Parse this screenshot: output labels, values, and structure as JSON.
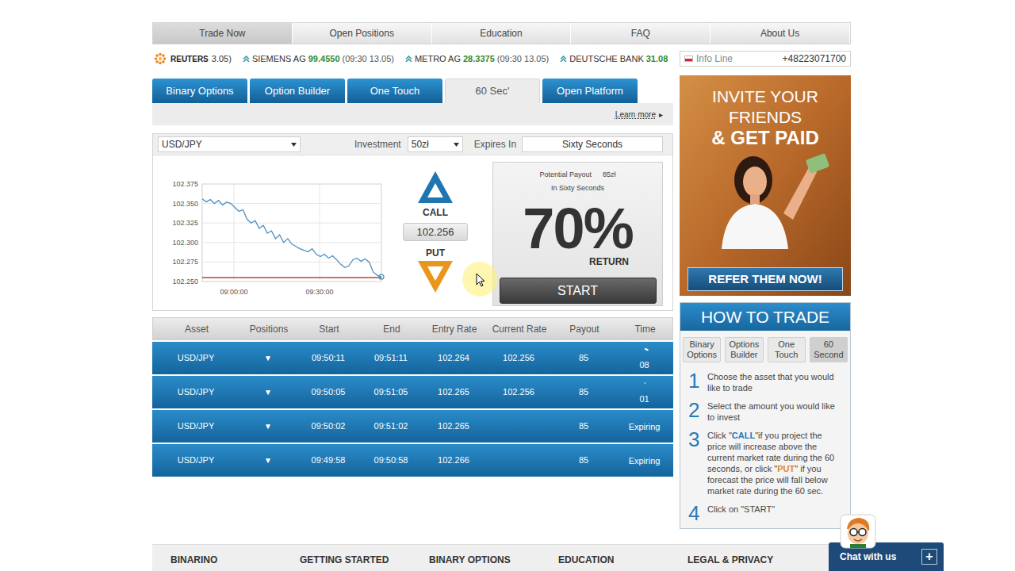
{
  "nav": [
    {
      "label": "Trade Now",
      "selected": true
    },
    {
      "label": "Open Positions",
      "selected": false
    },
    {
      "label": "Education",
      "selected": false
    },
    {
      "label": "FAQ",
      "selected": false
    },
    {
      "label": "About Us",
      "selected": false
    }
  ],
  "ticker": {
    "source": "REUTERS",
    "fragment": "3.05)",
    "items": [
      {
        "name": "SIEMENS AG",
        "value": "99.4550",
        "time": "(09:30 13.05)"
      },
      {
        "name": "METRO AG",
        "value": "28.3375",
        "time": "(09:30 13.05)"
      },
      {
        "name": "DEUTSCHE BANK",
        "value": "31.08"
      }
    ]
  },
  "info_line": {
    "label": "Info Line",
    "phone": "+48223071700"
  },
  "product_tabs": [
    {
      "label": "Binary Options",
      "selected": false
    },
    {
      "label": "Option Builder",
      "selected": false
    },
    {
      "label": "One Touch",
      "selected": false
    },
    {
      "label": "60 Sec'",
      "selected": true
    },
    {
      "label": "Open Platform",
      "selected": false
    }
  ],
  "learn_more": {
    "label": "Learn more",
    "arrow": "▸"
  },
  "trade": {
    "asset": "USD/JPY",
    "investment_label": "Investment",
    "investment": "50zł",
    "expires_label": "Expires In",
    "expires": "Sixty Seconds",
    "call_label": "CALL",
    "put_label": "PUT",
    "price": "102.256",
    "payout_label": "Potential Payout",
    "payout": "85zł",
    "payout_period": "In Sixty Seconds",
    "return_percent": "70%",
    "return_label": "RETURN",
    "start": "START"
  },
  "chart": {
    "y_ticks": [
      "102.375",
      "102.350",
      "102.325",
      "102.300",
      "102.275",
      "102.250"
    ],
    "x_ticks": [
      "09:00:00",
      "09:30:00"
    ],
    "series": [
      {
        "values": [
          102.356,
          102.352,
          102.355,
          102.35,
          102.354,
          102.348,
          102.352,
          102.35,
          102.345,
          102.34,
          102.342,
          102.33,
          102.325,
          102.328,
          102.318,
          102.322,
          102.312,
          102.315,
          102.305,
          102.31,
          102.3,
          102.305,
          102.298,
          102.295,
          102.292,
          102.29,
          102.288,
          102.292,
          102.285,
          102.282,
          102.285,
          102.28,
          102.283,
          102.278,
          102.272,
          102.268,
          102.27,
          102.278,
          102.28,
          102.276,
          102.279,
          102.275,
          102.262,
          102.258,
          102.256
        ]
      }
    ],
    "current_line": 102.255
  },
  "positions": {
    "columns": [
      "Asset",
      "Positions",
      "Start",
      "End",
      "Entry Rate",
      "Current Rate",
      "Payout",
      "Time"
    ],
    "rows": [
      {
        "asset": "USD/JPY",
        "position": "▼",
        "start": "09:50:11",
        "end": "09:51:11",
        "entry_rate": "102.264",
        "current_rate": "102.256",
        "payout": "85",
        "time": "08",
        "countdown_level": 0.13
      },
      {
        "asset": "USD/JPY",
        "position": "▼",
        "start": "09:50:05",
        "end": "09:51:05",
        "entry_rate": "102.265",
        "current_rate": "102.256",
        "payout": "85",
        "time": "01",
        "countdown_level": 0.02
      },
      {
        "asset": "USD/JPY",
        "position": "▼",
        "start": "09:50:02",
        "end": "09:51:02",
        "entry_rate": "102.265",
        "payout": "85",
        "time": "Expiring"
      },
      {
        "asset": "USD/JPY",
        "position": "▼",
        "start": "09:49:58",
        "end": "09:50:58",
        "entry_rate": "102.266",
        "payout": "85",
        "time": "Expiring"
      }
    ]
  },
  "banner": {
    "lines": [
      "INVITE YOUR",
      "FRIENDS",
      "& GET PAID"
    ],
    "button": "REFER THEM NOW!"
  },
  "how_to_trade": {
    "title": "HOW TO TRADE",
    "tabs": [
      {
        "label": "Binary Options",
        "selected": false
      },
      {
        "label": "Options Builder",
        "selected": false
      },
      {
        "label": "One Touch",
        "selected": false
      },
      {
        "label": "60 Second",
        "selected": true
      }
    ],
    "steps": [
      {
        "number": "1",
        "segments": [
          {
            "text": "Choose the asset that you would like to trade",
            "kind": "plain"
          }
        ]
      },
      {
        "number": "2",
        "segments": [
          {
            "text": "Select the amount you would like to invest",
            "kind": "plain"
          }
        ]
      },
      {
        "number": "3",
        "segments": [
          {
            "text": "Click \"",
            "kind": "plain"
          },
          {
            "text": "CALL",
            "kind": "call"
          },
          {
            "text": "\"if you project the price will increase above the current market rate during the 60 seconds, or click \"",
            "kind": "plain"
          },
          {
            "text": "PUT",
            "kind": "put"
          },
          {
            "text": "\" if you forecast the price will fall below market rate during the 60 sec.",
            "kind": "plain"
          }
        ]
      },
      {
        "number": "4",
        "segments": [
          {
            "text": "Click on \"START\"",
            "kind": "plain"
          }
        ]
      }
    ]
  },
  "footer": [
    "BINARINO",
    "GETTING STARTED",
    "BINARY OPTIONS",
    "EDUCATION",
    "LEGAL & PRIVACY"
  ],
  "chat": {
    "label": "Chat with us",
    "button": "+"
  }
}
